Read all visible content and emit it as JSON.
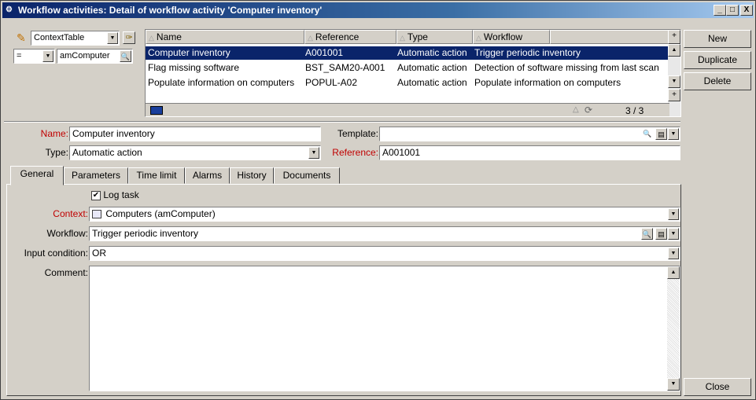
{
  "window": {
    "title": "Workflow activities: Detail of workflow activity 'Computer inventory'",
    "controls": [
      "_",
      "□",
      "X"
    ]
  },
  "filter": {
    "table_combo": "ContextTable",
    "operator": "=",
    "value": "amComputer"
  },
  "list": {
    "columns": [
      "Name",
      "Reference",
      "Type",
      "Workflow"
    ],
    "rows": [
      {
        "name": "Computer inventory",
        "reference": "A001001",
        "type": "Automatic action",
        "workflow": "Trigger periodic inventory",
        "selected": true
      },
      {
        "name": "Flag missing software",
        "reference": "BST_SAM20-A001",
        "type": "Automatic action",
        "workflow": "Detection of software missing from last scan",
        "selected": false
      },
      {
        "name": "Populate information on computers",
        "reference": "POPUL-A02",
        "type": "Automatic action",
        "workflow": "Populate information on computers",
        "selected": false
      }
    ],
    "count": "3 / 3"
  },
  "buttons": {
    "new": "New",
    "duplicate": "Duplicate",
    "delete": "Delete",
    "close": "Close"
  },
  "detail": {
    "name_label": "Name:",
    "name_value": "Computer inventory",
    "template_label": "Template:",
    "template_value": "",
    "type_label": "Type:",
    "type_value": "Automatic action",
    "reference_label": "Reference:",
    "reference_value": "A001001"
  },
  "tabs": [
    "General",
    "Parameters",
    "Time limit",
    "Alarms",
    "History",
    "Documents"
  ],
  "general": {
    "log_task_label": "Log task",
    "log_task_checked": true,
    "context_label": "Context:",
    "context_value": "Computers (amComputer)",
    "workflow_label": "Workflow:",
    "workflow_value": "Trigger periodic inventory",
    "input_condition_label": "Input condition:",
    "input_condition_value": "OR",
    "comment_label": "Comment:",
    "comment_value": ""
  }
}
